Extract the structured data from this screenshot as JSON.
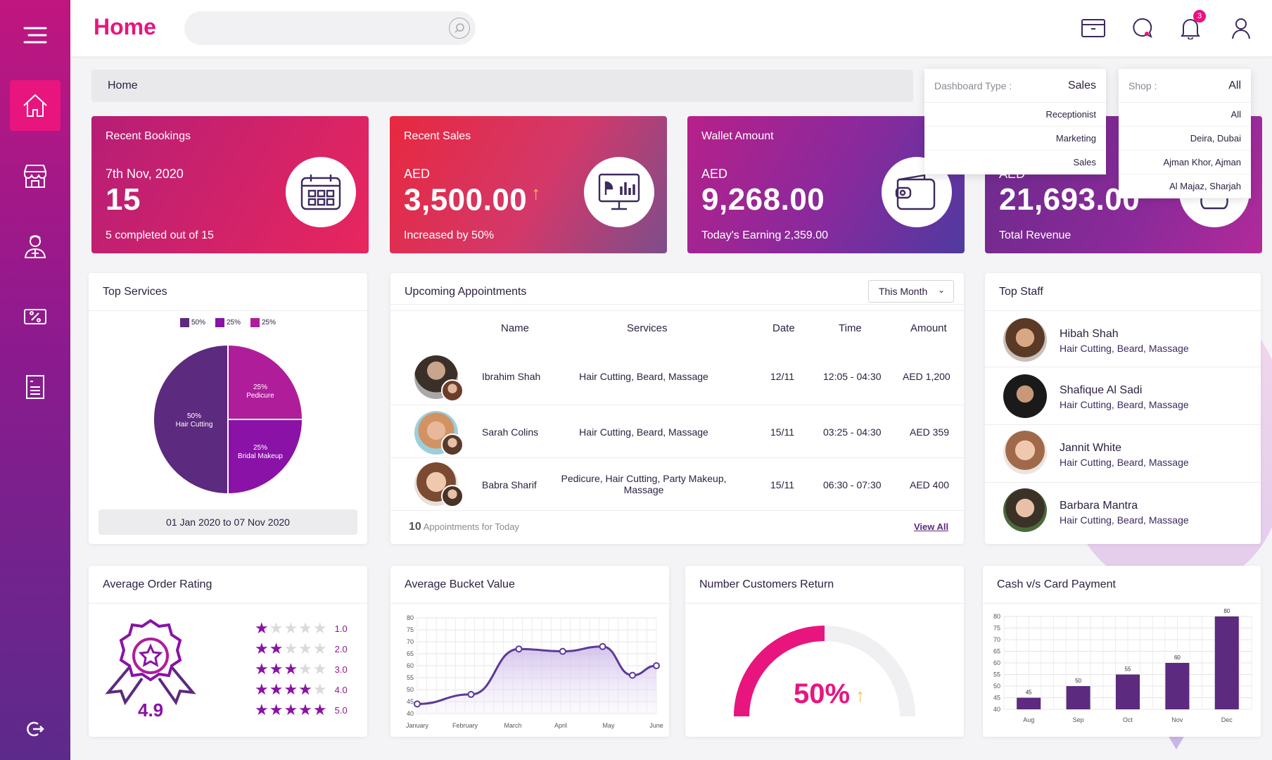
{
  "topbar": {
    "title": "Home",
    "notification_count": "3",
    "search_placeholder": ""
  },
  "breadcrumb": "Home",
  "dashboard_type": {
    "label": "Dashboard Type :",
    "value": "Sales",
    "options": [
      "Receptionist",
      "Marketing",
      "Sales"
    ]
  },
  "shop": {
    "label": "Shop :",
    "value": "All",
    "options": [
      "All",
      "Deira, Dubai",
      "Ajman Khor, Ajman",
      "Al Majaz, Sharjah"
    ]
  },
  "stats": [
    {
      "title": "Recent Bookings",
      "sub": "7th Nov, 2020",
      "value": "15",
      "foot": "5 completed out of  15",
      "icon": "calendar-icon"
    },
    {
      "title": "Recent Sales",
      "sub": "AED",
      "value": "3,500.00",
      "foot": "Increased by 50%",
      "icon": "monitor-chart-icon"
    },
    {
      "title": "Wallet Amount",
      "sub": "AED",
      "value": "9,268.00",
      "foot": "Today's Earning 2,359.00",
      "icon": "wallet-icon"
    },
    {
      "title": "",
      "sub": "AED",
      "value": "21,693.00",
      "foot": "Total Revenue",
      "icon": "money-bag-icon"
    }
  ],
  "top_services": {
    "title": "Top Services",
    "legend": [
      "50%",
      "25%",
      "25%"
    ],
    "slices": [
      {
        "pct": "50%",
        "label": "Hair Cutting",
        "value": 50,
        "color": "#5c2a7e"
      },
      {
        "pct": "25%",
        "label": "Pedicure",
        "value": 25,
        "color": "#b01d9a"
      },
      {
        "pct": "25%",
        "label": "Bridal Makeup",
        "value": 25,
        "color": "#8a12a6"
      }
    ],
    "date_range": "01 Jan 2020 to 07 Nov 2020"
  },
  "appointments": {
    "title": "Upcoming Appointments",
    "filter": "This Month",
    "headers": [
      "Name",
      "Services",
      "Date",
      "Time",
      "Amount"
    ],
    "rows": [
      {
        "name": "Ibrahim Shah",
        "services": "Hair Cutting, Beard, Massage",
        "date": "12/11",
        "time": "12:05 - 04:30",
        "amount": "AED 1,200"
      },
      {
        "name": "Sarah Colins",
        "services": "Hair Cutting, Beard, Massage",
        "date": "15/11",
        "time": "03:25 - 04:30",
        "amount": "AED 359"
      },
      {
        "name": "Babra Sharif",
        "services": "Pedicure, Hair Cutting, Party Makeup, Massage",
        "date": "15/11",
        "time": "06:30 - 07:30",
        "amount": "AED 400"
      }
    ],
    "count": "10",
    "count_text": "Appointments for Today",
    "view_all": "View All"
  },
  "top_staff": {
    "title": "Top Staff",
    "items": [
      {
        "name": "Hibah Shah",
        "services": "Hair Cutting, Beard, Massage"
      },
      {
        "name": "Shafique Al Sadi",
        "services": "Hair Cutting, Beard, Massage"
      },
      {
        "name": "Jannit White",
        "services": "Hair Cutting, Beard, Massage"
      },
      {
        "name": "Barbara Mantra",
        "services": "Hair Cutting, Beard, Massage"
      }
    ]
  },
  "avg_rating": {
    "title": "Average Order Rating",
    "score": "4.9",
    "rows": [
      {
        "stars": 1,
        "label": "1.0"
      },
      {
        "stars": 2,
        "label": "2.0"
      },
      {
        "stars": 3,
        "label": "3.0"
      },
      {
        "stars": 4,
        "label": "4.0"
      },
      {
        "stars": 5,
        "label": "5.0"
      }
    ]
  },
  "customers_return": {
    "title": "Number Customers Return",
    "value": "50%",
    "fraction": 0.5
  },
  "chart_data": [
    {
      "type": "line",
      "title": "Average Bucket Value",
      "categories": [
        "January",
        "February",
        "March",
        "April",
        "May",
        "June"
      ],
      "points": [
        [
          0,
          44
        ],
        [
          1.35,
          48
        ],
        [
          2.55,
          67
        ],
        [
          3.65,
          66
        ],
        [
          4.65,
          68
        ],
        [
          5.4,
          56
        ],
        [
          6,
          60
        ]
      ],
      "ylim": [
        40,
        80
      ],
      "yticks": [
        40,
        45,
        50,
        55,
        60,
        65,
        70,
        75,
        80
      ]
    },
    {
      "type": "bar",
      "title": "Cash v/s Card Payment",
      "categories": [
        "Aug",
        "Sep",
        "Oct",
        "Nov",
        "Dec"
      ],
      "values": [
        45,
        50,
        55,
        60,
        80
      ],
      "ylim": [
        40,
        80
      ],
      "yticks": [
        40,
        45,
        50,
        55,
        60,
        65,
        70,
        75,
        80
      ]
    }
  ]
}
